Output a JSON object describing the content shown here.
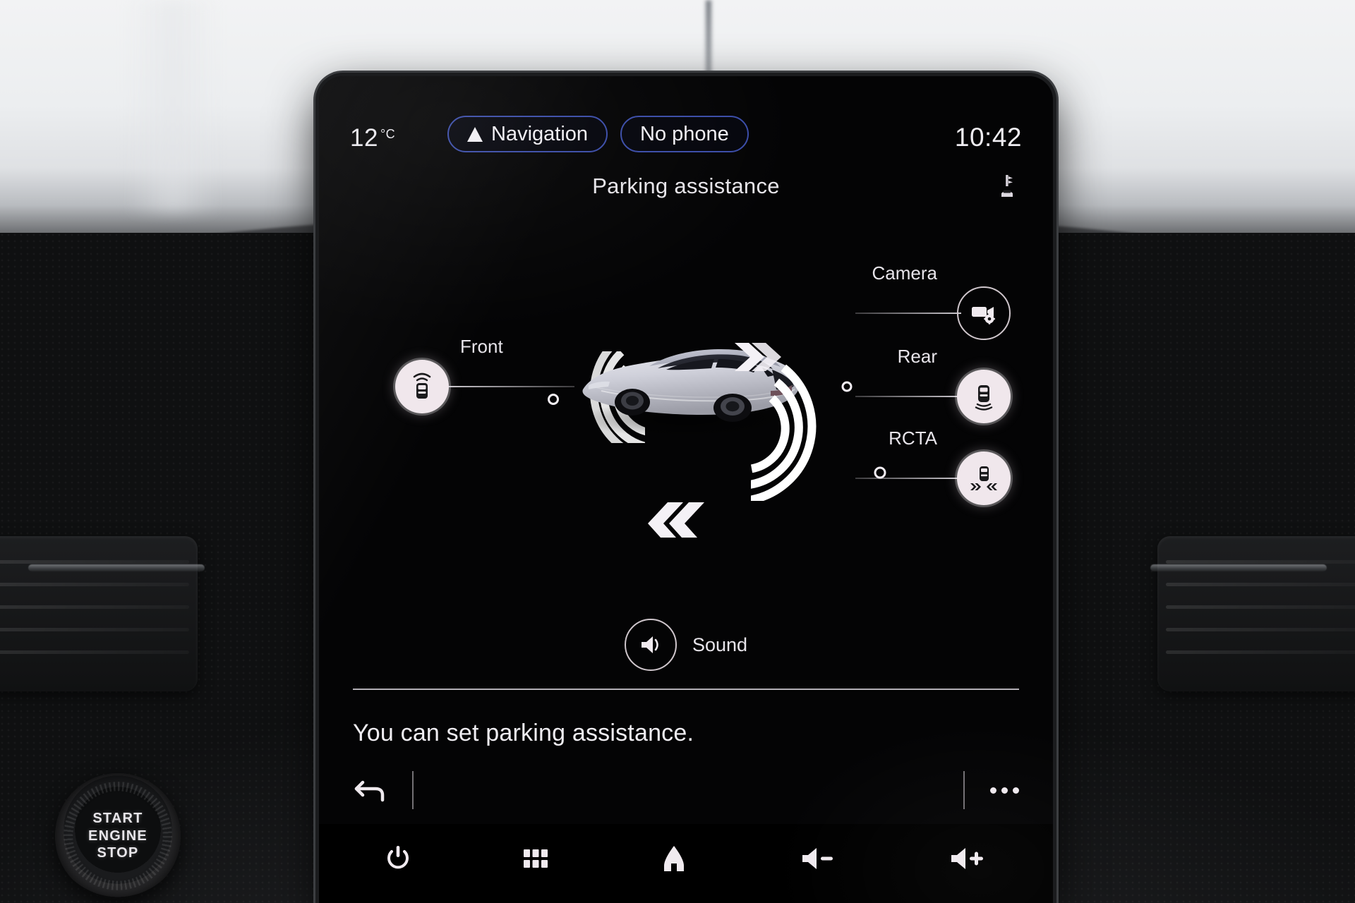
{
  "vehicle": {
    "start_button_lines": [
      "START",
      "ENGINE",
      "STOP"
    ]
  },
  "status_bar": {
    "temperature": "12",
    "temperature_unit": "°C",
    "navigation_label": "Navigation",
    "navigation_icon": "navigation-arrow-icon",
    "phone_label": "No phone",
    "clock": "10:42",
    "pill_border_color": "#3b4da8"
  },
  "header": {
    "title": "Parking assistance",
    "status_icon": "parking-sensor-icon"
  },
  "diagram": {
    "vehicle_illustration": "car-top-rear-three-quarter",
    "front_sensor_waves": "sensor-arc-icon",
    "rear_sensor_waves": "sensor-arc-icon",
    "chevron_rear": "chevron-arrows-icon",
    "chevron_bottom": "chevron-arrows-icon",
    "controls": [
      {
        "id": "front",
        "label": "Front",
        "icon": "car-front-sensor-icon",
        "active": true,
        "side": "left"
      },
      {
        "id": "camera",
        "label": "Camera",
        "icon": "camera-settings-icon",
        "active": false,
        "side": "right"
      },
      {
        "id": "rear",
        "label": "Rear",
        "icon": "car-rear-sensor-icon",
        "active": true,
        "side": "right"
      },
      {
        "id": "rcta",
        "label": "RCTA",
        "icon": "rcta-cross-traffic-icon",
        "active": true,
        "side": "right"
      }
    ],
    "sound": {
      "label": "Sound",
      "icon": "speaker-icon",
      "active": false
    }
  },
  "hint": {
    "text": "You can set parking assistance."
  },
  "soft_bar": {
    "back_icon": "back-arrow-icon",
    "more_icon": "more-options-icon"
  },
  "hardware_bar": {
    "buttons": [
      {
        "id": "power",
        "icon": "power-icon"
      },
      {
        "id": "apps",
        "icon": "apps-grid-icon"
      },
      {
        "id": "home",
        "icon": "home-icon"
      },
      {
        "id": "volume-down",
        "icon": "volume-down-icon"
      },
      {
        "id": "volume-up",
        "icon": "volume-up-icon"
      }
    ]
  },
  "theme": {
    "screen_background": "#040405",
    "text_color": "#e9e7ec",
    "accent_blue": "#3b4da8",
    "active_button_fill": "#f0e7ec",
    "inactive_button_stroke": "#cfc6cc"
  }
}
